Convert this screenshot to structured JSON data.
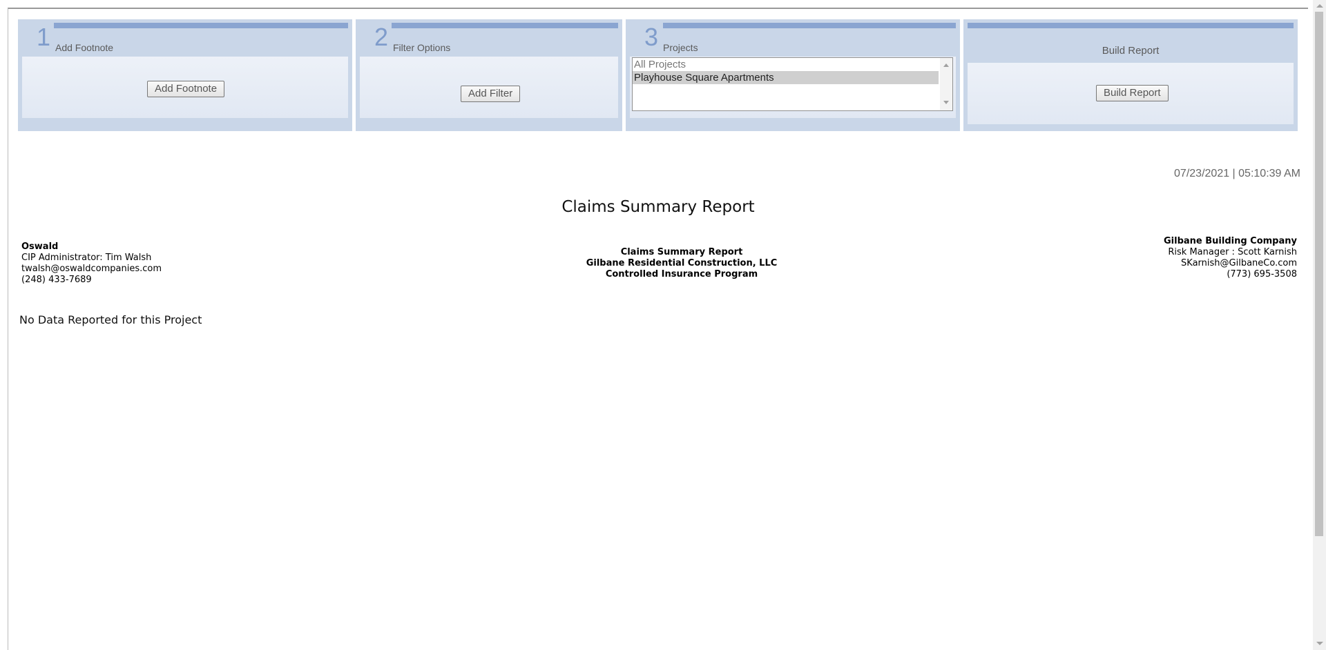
{
  "toolbar": {
    "step1": {
      "number": "1",
      "title": "Add Footnote",
      "button": "Add Footnote"
    },
    "step2": {
      "number": "2",
      "title": "Filter Options",
      "button": "Add Filter"
    },
    "step3": {
      "number": "3",
      "title": "Projects",
      "options": [
        "All Projects",
        "Playhouse Square Apartments"
      ],
      "selected": "Playhouse Square Apartments"
    },
    "step4": {
      "title": "Build Report",
      "button": "Build Report"
    }
  },
  "report": {
    "timestamp": "07/23/2021 | 05:10:39 AM",
    "title": "Claims Summary Report",
    "left_contact": {
      "company": "Oswald",
      "role": "CIP Administrator: Tim Walsh",
      "email": "twalsh@oswaldcompanies.com",
      "phone": "(248) 433-7689"
    },
    "center_heading": {
      "line1": "Claims Summary Report",
      "line2": "Gilbane Residential Construction, LLC",
      "line3": "Controlled Insurance Program"
    },
    "right_contact": {
      "company": "Gilbane Building Company",
      "role": "Risk Manager : Scott Karnish",
      "email": "SKarnish@GilbaneCo.com",
      "phone": "(773) 695-3508"
    },
    "message": "No Data Reported for this Project"
  },
  "colors": {
    "panel_bg": "#c9d6e8",
    "panel_accent": "#8aa5d1",
    "step_number": "#7f9ccb"
  }
}
